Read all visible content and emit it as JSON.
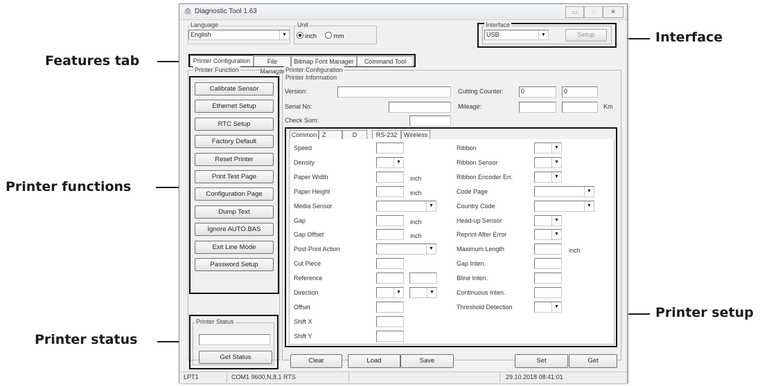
{
  "callouts": {
    "interface": "Interface",
    "features_tab": "Features tab",
    "printer_functions": "Printer functions",
    "printer_setup": "Printer setup",
    "printer_status": "Printer status"
  },
  "window": {
    "title": "Diagnostic Tool 1.63",
    "controls": {
      "minimize": "▭",
      "maximize": "□",
      "close": "✕"
    }
  },
  "language": {
    "label": "Language",
    "value": "English"
  },
  "unit": {
    "label": "Unit",
    "options": [
      "inch",
      "mm"
    ],
    "selected": "inch"
  },
  "interface": {
    "label": "Interface",
    "value": "USB",
    "setup_button": "Setup"
  },
  "tabs": [
    "Printer Configuration",
    "File Manager",
    "Bitmap Font Manager",
    "Command Tool"
  ],
  "printer_function": {
    "label": "Printer Function",
    "buttons": [
      "Calibrate Sensor",
      "Ethernet Setup",
      "RTC Setup",
      "Factory Default",
      "Reset Printer",
      "Print Test Page",
      "Configuration Page",
      "Dump Text",
      "Ignore AUTO.BAS",
      "Exit Line Mode",
      "Password Setup"
    ]
  },
  "printer_status": {
    "label": "Printer Status",
    "value": "",
    "button": "Get Status"
  },
  "printer_configuration": {
    "label": "Printer Configuration",
    "info_label": "Printer Information",
    "version_label": "Version:",
    "serial_label": "Serial No:",
    "checksum_label": "Check Sum:",
    "cutting_counter_label": "Cutting Counter:",
    "cutting_counter_values": [
      "0",
      "0"
    ],
    "mileage_label": "Mileage:",
    "mileage_unit": "Km"
  },
  "setup_tabs": [
    "Common",
    "Z",
    "D",
    "RS-232",
    "Wireless"
  ],
  "setup_left": [
    {
      "label": "Speed",
      "type": "text"
    },
    {
      "label": "Density",
      "type": "select"
    },
    {
      "label": "Paper Width",
      "type": "text",
      "unit": "inch"
    },
    {
      "label": "Paper Height",
      "type": "text",
      "unit": "inch"
    },
    {
      "label": "Media Sensor",
      "type": "select-wide"
    },
    {
      "label": "Gap",
      "type": "text",
      "unit": "inch"
    },
    {
      "label": "Gap Offset",
      "type": "text",
      "unit": "inch"
    },
    {
      "label": "Post-Print Action",
      "type": "select-wide"
    },
    {
      "label": "Cut Piece",
      "type": "text"
    },
    {
      "label": "Reference",
      "type": "text-pair"
    },
    {
      "label": "Direction",
      "type": "select-pair"
    },
    {
      "label": "Offset",
      "type": "text"
    },
    {
      "label": "Shift X",
      "type": "text"
    },
    {
      "label": "Shift Y",
      "type": "text"
    }
  ],
  "setup_right": [
    {
      "label": "Ribbon",
      "type": "select"
    },
    {
      "label": "Ribbon Sensor",
      "type": "select"
    },
    {
      "label": "Ribbon Encoder Err.",
      "type": "select"
    },
    {
      "label": "Code Page",
      "type": "select-wide"
    },
    {
      "label": "Country Code",
      "type": "select-wide"
    },
    {
      "label": "Head-up Sensor",
      "type": "select"
    },
    {
      "label": "Reprint After Error",
      "type": "select"
    },
    {
      "label": "Maximum Length",
      "type": "text",
      "unit": "inch"
    },
    {
      "label": "Gap Inten.",
      "type": "text"
    },
    {
      "label": "Bline Inten.",
      "type": "text"
    },
    {
      "label": "Continuous Inten.",
      "type": "text"
    },
    {
      "label": "Threshold Detection",
      "type": "select"
    }
  ],
  "bottom_buttons": {
    "clear": "Clear",
    "load": "Load",
    "save": "Save",
    "set": "Set",
    "get": "Get"
  },
  "statusbar": {
    "port": "LPT1",
    "com": "COM1 9600,N,8,1 RTS",
    "datetime": "29.10.2018 08:41:01"
  }
}
